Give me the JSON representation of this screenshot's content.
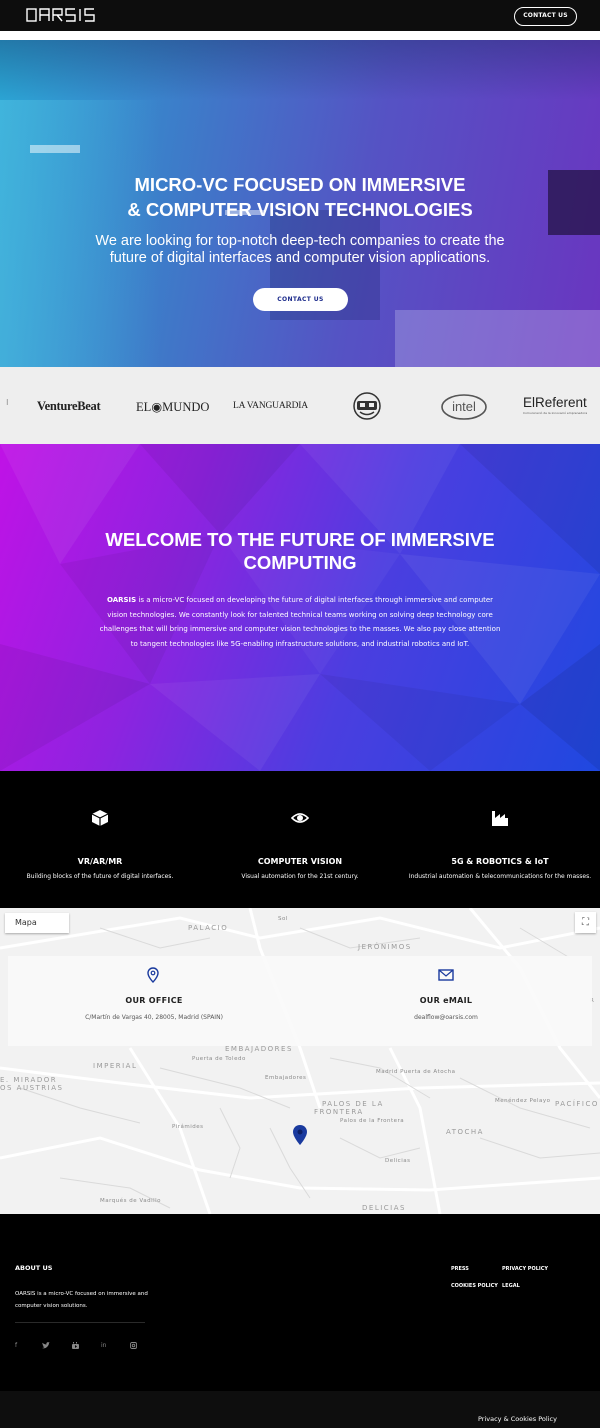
{
  "nav": {
    "logo": "OARSIS",
    "contact_label": "CONTACT US"
  },
  "hero": {
    "title_line1": "MICRO-VC FOCUSED ON IMMERSIVE",
    "title_line2": "& COMPUTER VISION TECHNOLOGIES",
    "subtitle": "We are looking for top-notch deep-tech companies to create the future of digital interfaces and computer vision applications.",
    "cta_label": "CONTACT US"
  },
  "press": {
    "logos": [
      "VentureBeat",
      "EL MUNDO",
      "LA VANGUARDIA",
      "VR headset logo",
      "intel",
      "ElReferent"
    ],
    "venturebeat": "VentureBeat",
    "elmundo": "EL◉MUNDO",
    "lavanguardia": "LA VANGUARDIA",
    "intel": "intel",
    "elreferent": "ElReferent",
    "elreferent_sub": "Comunicació de la innovació emprenedora"
  },
  "welcome": {
    "title": "WELCOME TO THE FUTURE OF IMMERSIVE COMPUTING",
    "brand": "OARSIS",
    "body": " is a micro-VC focused on developing the future of digital interfaces through immersive and computer vision technologies. We constantly look for talented technical teams working on solving deep technology core challenges that will bring immersive and computer vision technologies to the masses. We also pay close attention to tangent technologies like 5G-enabling infrastructure solutions, and industrial robotics and IoT."
  },
  "features": [
    {
      "icon": "cube-icon",
      "title": "VR/AR/MR",
      "desc": "Building blocks of the future of digital interfaces."
    },
    {
      "icon": "eye-icon",
      "title": "COMPUTER VISION",
      "desc": "Visual automation for the 21st century."
    },
    {
      "icon": "factory-icon",
      "title": "5G & ROBOTICS & IoT",
      "desc": "Industrial automation & telecommunications for the masses."
    }
  ],
  "map": {
    "type_label": "Mapa",
    "labels": {
      "palacio": "PALACIO",
      "sol": "Sol",
      "jeronimos": "JERÓNIMOS",
      "embajadores": "EMBAJADORES",
      "imperial": "IMPERIAL",
      "mirador": "E. MIRADOR",
      "austrias": "OS AUSTRIAS",
      "puerta_toledo": "Puerta de Toledo",
      "embajadores_st": "Embajadores",
      "palos": "PALOS DE LA",
      "frontera": "FRONTERA",
      "atocha": "ATOCHA",
      "palos_st": "Palos de la Frontera",
      "delicias_st": "Delicias",
      "delicias": "DELICIAS",
      "piramides": "Pirámides",
      "marques": "Marqués de Vadillo",
      "madrid_atocha": "Madrid Puerta de Atocha",
      "pacifico": "PACÍFICO",
      "menendez": "Menéndez Pelayo",
      "r": "R"
    }
  },
  "contact": {
    "office_title": "OUR OFFICE",
    "office_address": "C/Martín de Vargas 40, 28005, Madrid (SPAIN)",
    "email_title": "OUR eMAIL",
    "email_address": "dealflow@oarsis.com"
  },
  "footer": {
    "about_title": "ABOUT US",
    "about_text": "OARSIS is a micro-VC focused on immersive and computer vision solutions.",
    "social": [
      "f",
      "twitter",
      "youtube",
      "in",
      "instagram"
    ],
    "links": {
      "press": "PRESS",
      "privacy": "PRIVACY POLICY",
      "cookies": "COOKIES POLICY",
      "legal": "LEGAL"
    },
    "bottom_link": "Privacy & Cookies Policy"
  },
  "colors": {
    "accent": "#1d2c8c",
    "pin": "#1a3a9e"
  }
}
